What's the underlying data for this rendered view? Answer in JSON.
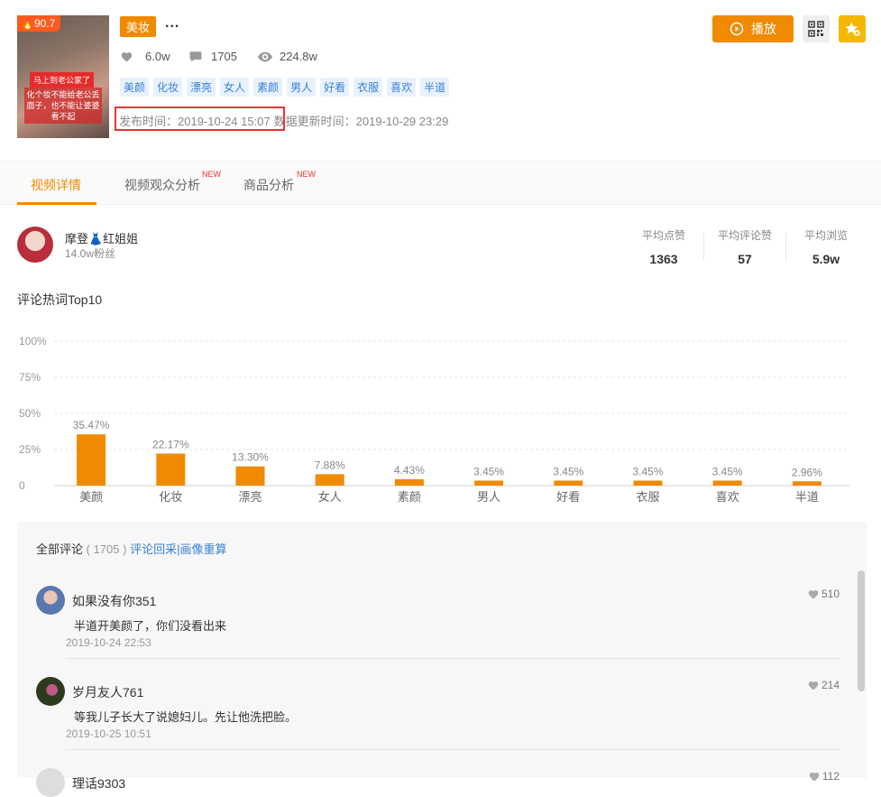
{
  "video": {
    "score": "90.7",
    "thumb_caption_1": "马上到老公家了",
    "thumb_caption_2": "化个妆不能给老公丢面子，也不能让婆婆看不起",
    "category": "美妆",
    "more": "...",
    "likes": "6.0w",
    "comments": "1705",
    "views": "224.8w",
    "tags": [
      "美颜",
      "化妆",
      "漂亮",
      "女人",
      "素颜",
      "男人",
      "好看",
      "衣服",
      "喜欢",
      "半道"
    ],
    "publish_time": "发布时间：2019-10-24 15:07",
    "update_time": "数据更新时间：2019-10-29 23:29",
    "play_label": "播放"
  },
  "tabs": [
    {
      "label": "视频详情",
      "new": ""
    },
    {
      "label": "视频观众分析",
      "new": "NEW"
    },
    {
      "label": "商品分析",
      "new": "NEW"
    }
  ],
  "author": {
    "name": "摩登👗红姐姐",
    "fans": "14.0w粉丝",
    "stats": [
      {
        "label": "平均点赞",
        "value": "1363"
      },
      {
        "label": "平均评论赞",
        "value": "57"
      },
      {
        "label": "平均浏览",
        "value": "5.9w"
      }
    ]
  },
  "section_title": "评论热词Top10",
  "chart_data": {
    "type": "bar",
    "categories": [
      "美颜",
      "化妆",
      "漂亮",
      "女人",
      "素颜",
      "男人",
      "好看",
      "衣服",
      "喜欢",
      "半道"
    ],
    "values": [
      35.47,
      22.17,
      13.3,
      7.88,
      4.43,
      3.45,
      3.45,
      3.45,
      3.45,
      2.96
    ],
    "value_labels": [
      "35.47%",
      "22.17%",
      "13.30%",
      "7.88%",
      "4.43%",
      "3.45%",
      "3.45%",
      "3.45%",
      "3.45%",
      "2.96%"
    ],
    "yticks": [
      "0",
      "25%",
      "50%",
      "75%",
      "100%"
    ],
    "ylim": [
      0,
      100
    ],
    "grid": true,
    "bar_color": "#f08a00"
  },
  "comments": {
    "title": "全部评论",
    "count": "( 1705 )",
    "link": "评论回采|画像重算",
    "items": [
      {
        "name": "如果没有你351",
        "text": "半道开美颜了，你们没看出来",
        "date": "2019-10-24 22:53",
        "likes": "510"
      },
      {
        "name": "岁月友人761",
        "text": "等我儿子长大了说媳妇儿。先让他洗把脸。",
        "date": "2019-10-25 10:51",
        "likes": "214"
      },
      {
        "name": "理话9303",
        "text": "",
        "date": "",
        "likes": "112"
      }
    ]
  },
  "colors": {
    "accent": "#f08a00",
    "link": "#3a7fd6",
    "highlight_box": "#e33333"
  }
}
